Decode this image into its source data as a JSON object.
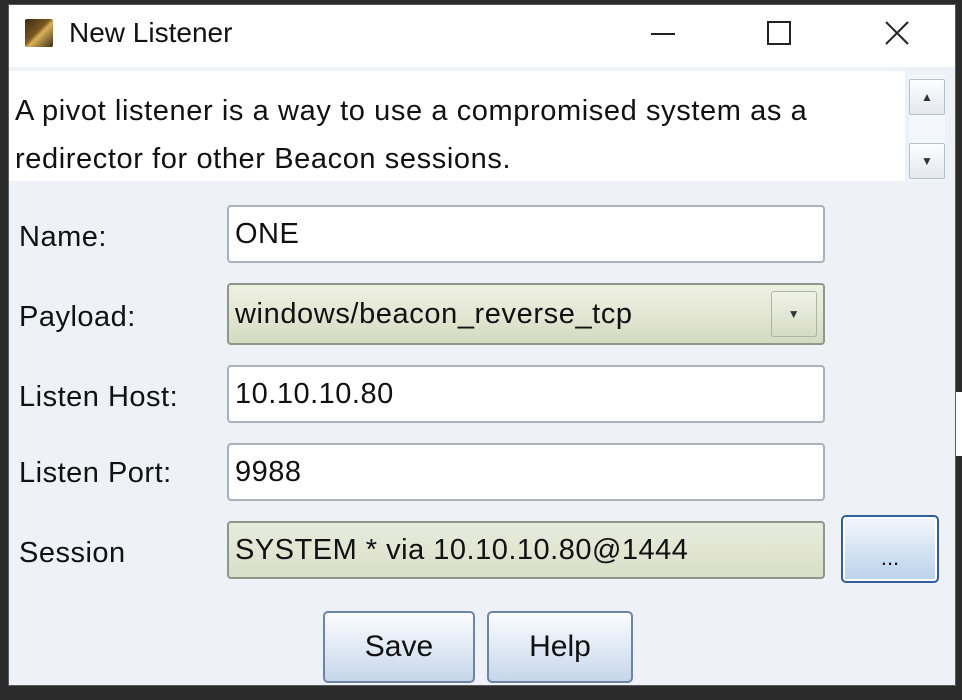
{
  "window": {
    "title": "New Listener",
    "icon": "cobalt-strike-app-icon",
    "controls": {
      "minimize_icon": "minimize-icon",
      "maximize_icon": "maximize-icon",
      "close_icon": "close-icon"
    }
  },
  "description": "A pivot listener is a way to use a compromised system as a redirector for other Beacon sessions.",
  "form": {
    "name_label": "Name:",
    "name_value": "ONE",
    "payload_label": "Payload:",
    "payload_value": "windows/beacon_reverse_tcp",
    "listen_host_label": "Listen Host:",
    "listen_host_value": "10.10.10.80",
    "listen_port_label": "Listen Port:",
    "listen_port_value": "9988",
    "session_label": "Session",
    "session_value": "SYSTEM * via  10.10.10.80@1444",
    "browse_label": "..."
  },
  "buttons": {
    "save_label": "Save",
    "help_label": "Help"
  },
  "colors": {
    "dialog_background": "#eef2f7",
    "readonly_field": "#e2e6d2",
    "focus_border": "#2f5f9e"
  }
}
